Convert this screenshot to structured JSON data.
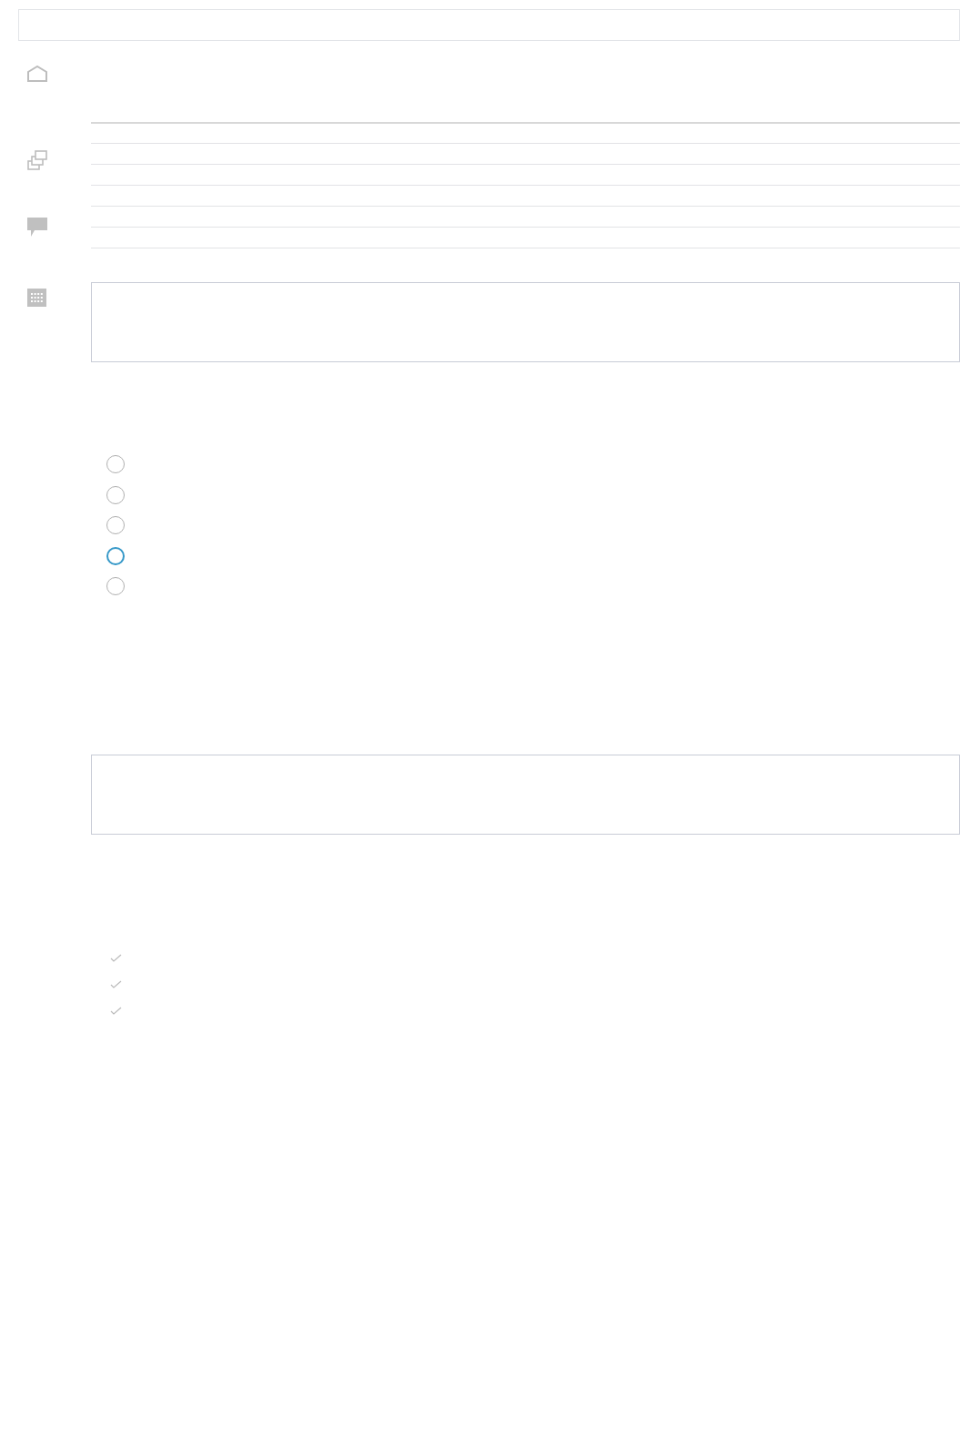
{
  "top_bar": {
    "kind": "bar"
  },
  "side_icons": [
    {
      "kind": "home"
    },
    {
      "kind": "windows"
    },
    {
      "kind": "comment"
    },
    {
      "kind": "calendar"
    }
  ],
  "table": {
    "rows": [
      {
        "kind": "row"
      },
      {
        "kind": "row"
      },
      {
        "kind": "row"
      },
      {
        "kind": "row"
      },
      {
        "kind": "row"
      },
      {
        "kind": "row"
      }
    ]
  },
  "boxes": [
    {
      "kind": "field"
    },
    {
      "kind": "field"
    }
  ],
  "radio_options": [
    {
      "color": "#b0b0b0"
    },
    {
      "color": "#b0b0b0"
    },
    {
      "color": "#b0b0b0"
    },
    {
      "color": "#3598c8"
    },
    {
      "color": "#b0b0b0"
    }
  ],
  "checklist": [
    {
      "kind": "check"
    },
    {
      "kind": "check"
    },
    {
      "kind": "check"
    }
  ]
}
